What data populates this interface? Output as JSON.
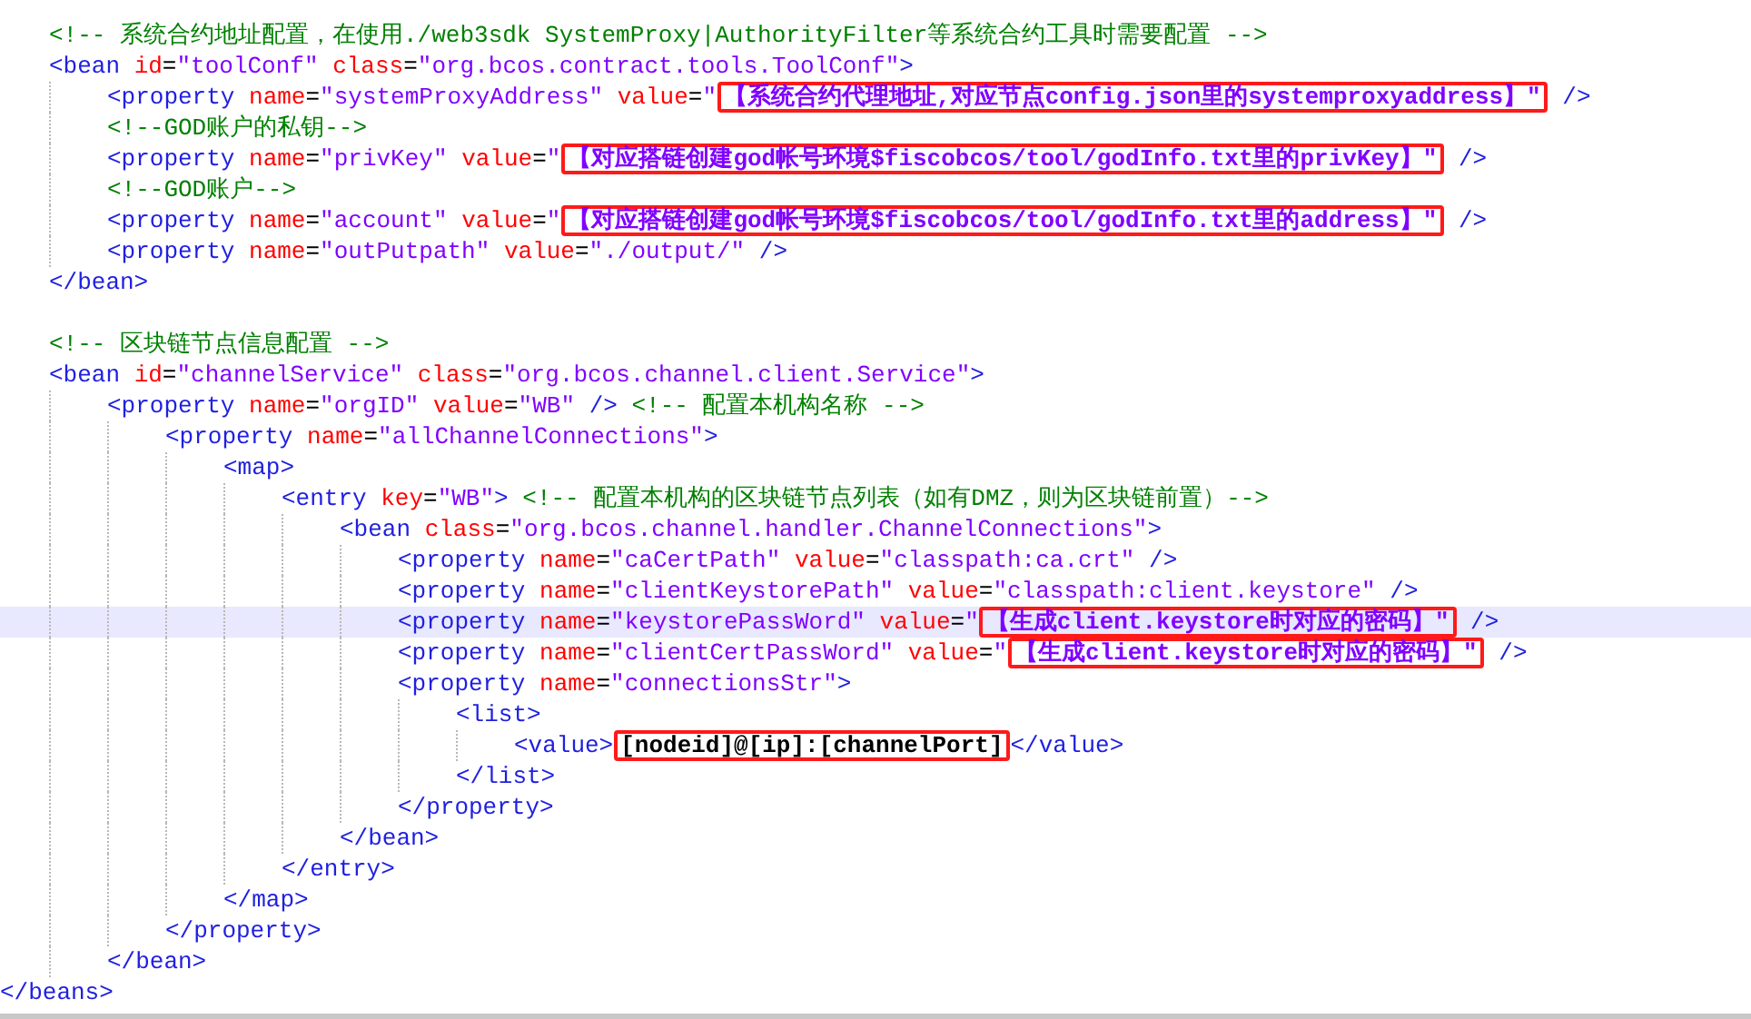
{
  "editor": {
    "lines": [
      {
        "highlighted": false,
        "tokens": [
          {
            "kind": "comment",
            "text": "<!-- 系统合约地址配置，在使用./web3sdk SystemProxy|AuthorityFilter等系统合约工具时需要配置 -->"
          }
        ]
      },
      {
        "highlighted": false,
        "tokens": [
          {
            "kind": "tag",
            "text": "<bean "
          },
          {
            "kind": "attr",
            "text": "id"
          },
          {
            "kind": "eq",
            "text": "="
          },
          {
            "kind": "string",
            "text": "\"toolConf\" "
          },
          {
            "kind": "attr",
            "text": "class"
          },
          {
            "kind": "eq",
            "text": "="
          },
          {
            "kind": "string",
            "text": "\"org.bcos.contract.tools.ToolConf\""
          },
          {
            "kind": "tag",
            "text": ">"
          }
        ],
        "children": [
          {
            "highlighted": false,
            "tokens": [
              {
                "kind": "tag",
                "text": "<property "
              },
              {
                "kind": "attr",
                "text": "name"
              },
              {
                "kind": "eq",
                "text": "="
              },
              {
                "kind": "string",
                "text": "\"systemProxyAddress\" "
              },
              {
                "kind": "attr",
                "text": "value"
              },
              {
                "kind": "eq",
                "text": "="
              },
              {
                "kind": "string",
                "text": "\""
              },
              {
                "kind": "filled",
                "boxed": true,
                "text": "【系统合约代理地址,对应节点config.json里的systemproxyaddress】\""
              },
              {
                "kind": "tag",
                "text": " />"
              }
            ]
          },
          {
            "highlighted": false,
            "tokens": [
              {
                "kind": "comment",
                "text": "<!--GOD账户的私钥-->"
              }
            ]
          },
          {
            "highlighted": false,
            "tokens": [
              {
                "kind": "tag",
                "text": "<property "
              },
              {
                "kind": "attr",
                "text": "name"
              },
              {
                "kind": "eq",
                "text": "="
              },
              {
                "kind": "string",
                "text": "\"privKey\" "
              },
              {
                "kind": "attr",
                "text": "value"
              },
              {
                "kind": "eq",
                "text": "="
              },
              {
                "kind": "string",
                "text": "\""
              },
              {
                "kind": "filled",
                "boxed": true,
                "text": "【对应搭链创建god帐号环境$fiscobcos/tool/godInfo.txt里的privKey】\""
              },
              {
                "kind": "tag",
                "text": " />"
              }
            ]
          },
          {
            "highlighted": false,
            "tokens": [
              {
                "kind": "comment",
                "text": "<!--GOD账户-->"
              }
            ]
          },
          {
            "highlighted": false,
            "tokens": [
              {
                "kind": "tag",
                "text": "<property "
              },
              {
                "kind": "attr",
                "text": "name"
              },
              {
                "kind": "eq",
                "text": "="
              },
              {
                "kind": "string",
                "text": "\"account\" "
              },
              {
                "kind": "attr",
                "text": "value"
              },
              {
                "kind": "eq",
                "text": "="
              },
              {
                "kind": "string",
                "text": "\""
              },
              {
                "kind": "filled",
                "boxed": true,
                "text": "【对应搭链创建god帐号环境$fiscobcos/tool/godInfo.txt里的address】\""
              },
              {
                "kind": "tag",
                "text": " />"
              }
            ]
          },
          {
            "highlighted": false,
            "tokens": [
              {
                "kind": "tag",
                "text": "<property "
              },
              {
                "kind": "attr",
                "text": "name"
              },
              {
                "kind": "eq",
                "text": "="
              },
              {
                "kind": "string",
                "text": "\"outPutpath\" "
              },
              {
                "kind": "attr",
                "text": "value"
              },
              {
                "kind": "eq",
                "text": "="
              },
              {
                "kind": "string",
                "text": "\"./output/\""
              },
              {
                "kind": "tag",
                "text": " />"
              }
            ]
          }
        ]
      },
      {
        "highlighted": false,
        "tokens": [
          {
            "kind": "tag",
            "text": "</bean>"
          }
        ]
      },
      {
        "highlighted": false
      },
      {
        "highlighted": false,
        "tokens": [
          {
            "kind": "comment",
            "text": "<!-- 区块链节点信息配置 -->"
          }
        ]
      },
      {
        "highlighted": false,
        "tokens": [
          {
            "kind": "tag",
            "text": "<bean "
          },
          {
            "kind": "attr",
            "text": "id"
          },
          {
            "kind": "eq",
            "text": "="
          },
          {
            "kind": "string",
            "text": "\"channelService\" "
          },
          {
            "kind": "attr",
            "text": "class"
          },
          {
            "kind": "eq",
            "text": "="
          },
          {
            "kind": "string",
            "text": "\"org.bcos.channel.client.Service\""
          },
          {
            "kind": "tag",
            "text": ">"
          }
        ],
        "children": [
          {
            "highlighted": false,
            "tokens": [
              {
                "kind": "tag",
                "text": "<property "
              },
              {
                "kind": "attr",
                "text": "name"
              },
              {
                "kind": "eq",
                "text": "="
              },
              {
                "kind": "string",
                "text": "\"orgID\" "
              },
              {
                "kind": "attr",
                "text": "value"
              },
              {
                "kind": "eq",
                "text": "="
              },
              {
                "kind": "string",
                "text": "\"WB\" "
              },
              {
                "kind": "tag",
                "text": "/> "
              },
              {
                "kind": "comment",
                "text": "<!-- 配置本机构名称 -->"
              }
            ],
            "children": [
              {
                "highlighted": false,
                "tokens": [
                  {
                    "kind": "tag",
                    "text": "<property "
                  },
                  {
                    "kind": "attr",
                    "text": "name"
                  },
                  {
                    "kind": "eq",
                    "text": "="
                  },
                  {
                    "kind": "string",
                    "text": "\"allChannelConnections\""
                  },
                  {
                    "kind": "tag",
                    "text": ">"
                  }
                ],
                "children": [
                  {
                    "highlighted": false,
                    "tokens": [
                      {
                        "kind": "tag",
                        "text": "<map>"
                      }
                    ],
                    "children": [
                      {
                        "highlighted": false,
                        "tokens": [
                          {
                            "kind": "tag",
                            "text": "<entry "
                          },
                          {
                            "kind": "attr",
                            "text": "key"
                          },
                          {
                            "kind": "eq",
                            "text": "="
                          },
                          {
                            "kind": "string",
                            "text": "\"WB\""
                          },
                          {
                            "kind": "tag",
                            "text": "> "
                          },
                          {
                            "kind": "comment",
                            "text": "<!-- 配置本机构的区块链节点列表（如有DMZ，则为区块链前置）-->"
                          }
                        ],
                        "children": [
                          {
                            "highlighted": false,
                            "tokens": [
                              {
                                "kind": "tag",
                                "text": "<bean "
                              },
                              {
                                "kind": "attr",
                                "text": "class"
                              },
                              {
                                "kind": "eq",
                                "text": "="
                              },
                              {
                                "kind": "string",
                                "text": "\"org.bcos.channel.handler.ChannelConnections\""
                              },
                              {
                                "kind": "tag",
                                "text": ">"
                              }
                            ],
                            "children": [
                              {
                                "highlighted": false,
                                "tokens": [
                                  {
                                    "kind": "tag",
                                    "text": "<property "
                                  },
                                  {
                                    "kind": "attr",
                                    "text": "name"
                                  },
                                  {
                                    "kind": "eq",
                                    "text": "="
                                  },
                                  {
                                    "kind": "string",
                                    "text": "\"caCertPath\" "
                                  },
                                  {
                                    "kind": "attr",
                                    "text": "value"
                                  },
                                  {
                                    "kind": "eq",
                                    "text": "="
                                  },
                                  {
                                    "kind": "string",
                                    "text": "\"classpath:ca.crt\""
                                  },
                                  {
                                    "kind": "tag",
                                    "text": " />"
                                  }
                                ]
                              },
                              {
                                "highlighted": false,
                                "tokens": [
                                  {
                                    "kind": "tag",
                                    "text": "<property "
                                  },
                                  {
                                    "kind": "attr",
                                    "text": "name"
                                  },
                                  {
                                    "kind": "eq",
                                    "text": "="
                                  },
                                  {
                                    "kind": "string",
                                    "text": "\"clientKeystorePath\" "
                                  },
                                  {
                                    "kind": "attr",
                                    "text": "value"
                                  },
                                  {
                                    "kind": "eq",
                                    "text": "="
                                  },
                                  {
                                    "kind": "string",
                                    "text": "\"classpath:client.keystore\""
                                  },
                                  {
                                    "kind": "tag",
                                    "text": " />"
                                  }
                                ]
                              },
                              {
                                "highlighted": true,
                                "tokens": [
                                  {
                                    "kind": "tag",
                                    "text": "<property "
                                  },
                                  {
                                    "kind": "attr",
                                    "text": "name"
                                  },
                                  {
                                    "kind": "eq",
                                    "text": "="
                                  },
                                  {
                                    "kind": "string",
                                    "text": "\"keystorePassWord\" "
                                  },
                                  {
                                    "kind": "attr",
                                    "text": "value"
                                  },
                                  {
                                    "kind": "eq",
                                    "text": "="
                                  },
                                  {
                                    "kind": "string",
                                    "text": "\""
                                  },
                                  {
                                    "kind": "filled",
                                    "boxed": true,
                                    "text": "【生成client.keystore时对应的密码】\""
                                  },
                                  {
                                    "kind": "tag",
                                    "text": " />"
                                  }
                                ]
                              },
                              {
                                "highlighted": false,
                                "tokens": [
                                  {
                                    "kind": "tag",
                                    "text": "<property "
                                  },
                                  {
                                    "kind": "attr",
                                    "text": "name"
                                  },
                                  {
                                    "kind": "eq",
                                    "text": "="
                                  },
                                  {
                                    "kind": "string",
                                    "text": "\"clientCertPassWord\" "
                                  },
                                  {
                                    "kind": "attr",
                                    "text": "value"
                                  },
                                  {
                                    "kind": "eq",
                                    "text": "="
                                  },
                                  {
                                    "kind": "string",
                                    "text": "\""
                                  },
                                  {
                                    "kind": "filled",
                                    "boxed": true,
                                    "text": "【生成client.keystore时对应的密码】\""
                                  },
                                  {
                                    "kind": "tag",
                                    "text": " />"
                                  }
                                ]
                              },
                              {
                                "highlighted": false,
                                "tokens": [
                                  {
                                    "kind": "tag",
                                    "text": "<property "
                                  },
                                  {
                                    "kind": "attr",
                                    "text": "name"
                                  },
                                  {
                                    "kind": "eq",
                                    "text": "="
                                  },
                                  {
                                    "kind": "string",
                                    "text": "\"connectionsStr\""
                                  },
                                  {
                                    "kind": "tag",
                                    "text": ">"
                                  }
                                ],
                                "children": [
                                  {
                                    "highlighted": false,
                                    "tokens": [
                                      {
                                        "kind": "tag",
                                        "text": "<list>"
                                      }
                                    ],
                                    "children": [
                                      {
                                        "highlighted": false,
                                        "tokens": [
                                          {
                                            "kind": "tag",
                                            "text": "<value>"
                                          },
                                          {
                                            "kind": "text",
                                            "boxed": true,
                                            "text": "[nodeid]@[ip]:[channelPort]"
                                          },
                                          {
                                            "kind": "tag",
                                            "text": "</value>"
                                          }
                                        ]
                                      }
                                    ]
                                  },
                                  {
                                    "highlighted": false,
                                    "tokens": [
                                      {
                                        "kind": "tag",
                                        "text": "</list>"
                                      }
                                    ]
                                  }
                                ]
                              },
                              {
                                "highlighted": false,
                                "tokens": [
                                  {
                                    "kind": "tag",
                                    "text": "</property>"
                                  }
                                ]
                              }
                            ]
                          },
                          {
                            "highlighted": false,
                            "tokens": [
                              {
                                "kind": "tag",
                                "text": "</bean>"
                              }
                            ]
                          }
                        ]
                      },
                      {
                        "highlighted": false,
                        "tokens": [
                          {
                            "kind": "tag",
                            "text": "</entry>"
                          }
                        ]
                      }
                    ]
                  },
                  {
                    "highlighted": false,
                    "tokens": [
                      {
                        "kind": "tag",
                        "text": "</map>"
                      }
                    ]
                  }
                ]
              },
              {
                "highlighted": false,
                "tokens": [
                  {
                    "kind": "tag",
                    "text": "</property>"
                  }
                ]
              }
            ]
          },
          {
            "highlighted": false,
            "tokens": [
              {
                "kind": "tag",
                "text": "</bean>"
              }
            ]
          }
        ]
      }
    ],
    "closing_line": {
      "highlighted": false,
      "tokens": [
        {
          "kind": "tag",
          "text": "</beans>"
        }
      ]
    }
  }
}
